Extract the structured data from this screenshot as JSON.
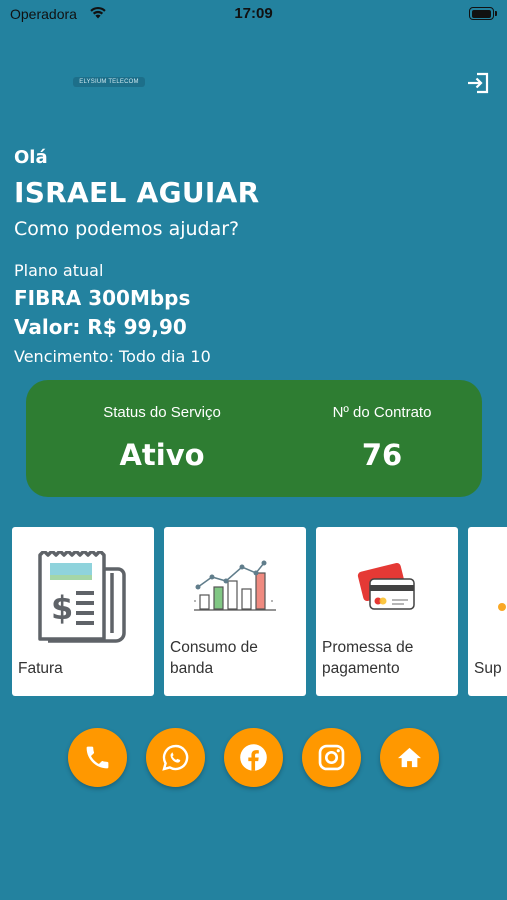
{
  "status_bar": {
    "carrier": "Operadora",
    "time": "17:09"
  },
  "header": {
    "logo_text": "ELYSIUM TELECOM"
  },
  "greeting": {
    "hello": "Olá",
    "name": "ISRAEL AGUIAR",
    "help": "Como podemos ajudar?"
  },
  "plan": {
    "label": "Plano atual",
    "name": "FIBRA 300Mbps",
    "value": "Valor: R$ 99,90",
    "due": "Vencimento: Todo dia 10"
  },
  "service": {
    "status_label": "Status do Serviço",
    "status_value": "Ativo",
    "contract_label": "Nº do Contrato",
    "contract_value": "76"
  },
  "menu": [
    {
      "label": "Fatura",
      "icon": "invoice-icon"
    },
    {
      "label": "Consumo de banda",
      "icon": "bandwidth-chart-icon"
    },
    {
      "label": "Promessa de pagamento",
      "icon": "credit-card-icon"
    },
    {
      "label": "Sup",
      "icon": "support-icon"
    }
  ],
  "contacts": [
    {
      "icon": "phone-icon"
    },
    {
      "icon": "whatsapp-icon"
    },
    {
      "icon": "facebook-icon"
    },
    {
      "icon": "instagram-icon"
    },
    {
      "icon": "home-icon"
    }
  ],
  "colors": {
    "background": "#23829f",
    "status_card": "#2e7d32",
    "accent": "#ff9800"
  }
}
